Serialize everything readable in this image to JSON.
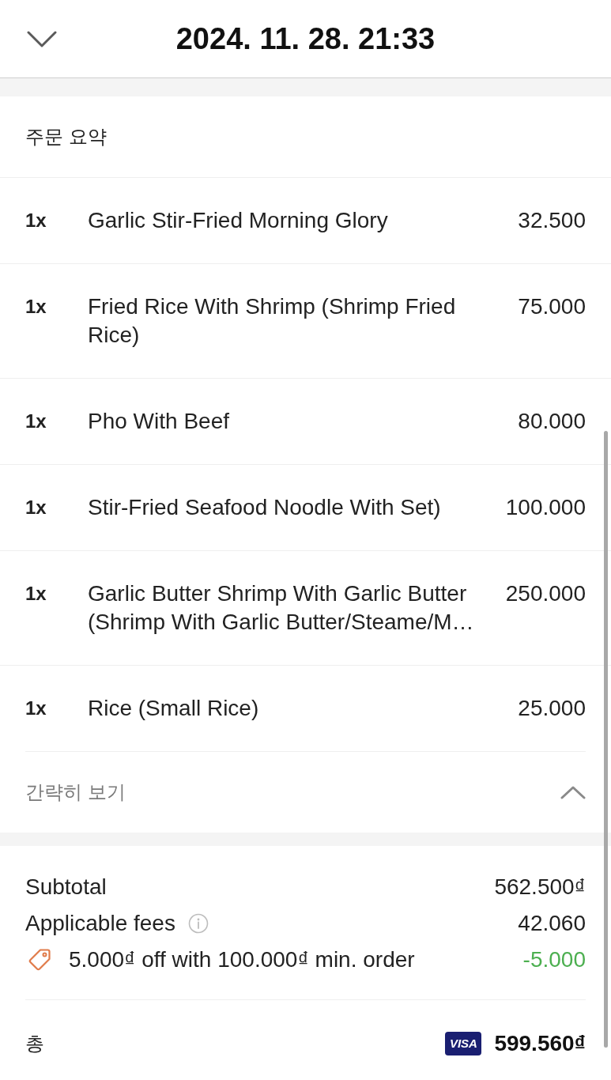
{
  "header": {
    "title": "2024. 11. 28. 21:33"
  },
  "order_summary": {
    "title": "주문 요약",
    "items": [
      {
        "quantity": "1x",
        "name": "Garlic Stir-Fried Morning Glory",
        "price": "32.500"
      },
      {
        "quantity": "1x",
        "name": "Fried Rice With Shrimp (Shrimp Fried Rice)",
        "price": "75.000"
      },
      {
        "quantity": "1x",
        "name": "Pho With Beef",
        "price": "80.000"
      },
      {
        "quantity": "1x",
        "name": "Stir-Fried Seafood Noodle With Set)",
        "price": "100.000"
      },
      {
        "quantity": "1x",
        "name": "Garlic Butter Shrimp With Garlic Butter (Shrimp With Garlic Butter/Steame/M…",
        "price": "250.000"
      },
      {
        "quantity": "1x",
        "name": "Rice (Small Rice)",
        "price": "25.000"
      }
    ],
    "toggle": {
      "label": "간략히 보기",
      "expanded": true
    }
  },
  "totals": {
    "lines": [
      {
        "kind": "subtotal",
        "label": "Subtotal",
        "amount": "562.500₫"
      },
      {
        "kind": "fee",
        "label": "Applicable fees",
        "amount": "42.060"
      },
      {
        "kind": "discount",
        "label": "5.000₫ off with 100.000₫ min. order",
        "amount": "-5.000"
      }
    ],
    "total": {
      "label": "총",
      "card_brand": "VISA",
      "amount": "599.560₫"
    }
  }
}
